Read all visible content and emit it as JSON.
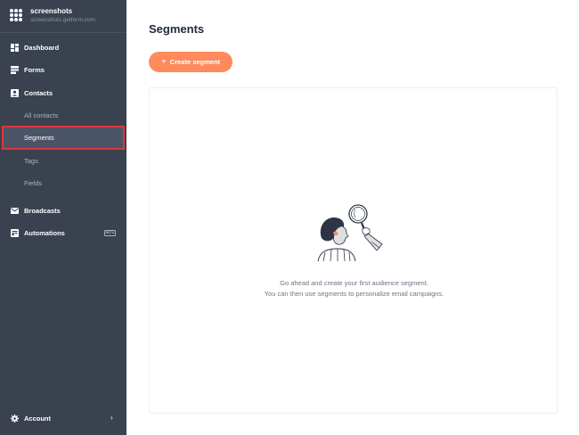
{
  "brand": {
    "name": "screenshots",
    "url": "screenshots.getform.com"
  },
  "sidebar": {
    "items": [
      {
        "label": "Dashboard",
        "icon": "dashboard-icon"
      },
      {
        "label": "Forms",
        "icon": "forms-icon"
      },
      {
        "label": "Contacts",
        "icon": "contacts-icon"
      }
    ],
    "contacts_sub": [
      {
        "label": "All contacts"
      },
      {
        "label": "Segments",
        "active": true
      },
      {
        "label": "Tags"
      },
      {
        "label": "Fields"
      }
    ],
    "broadcasts": {
      "label": "Broadcasts",
      "icon": "mail-icon"
    },
    "automations": {
      "label": "Automations",
      "icon": "automations-icon",
      "badge": "BETA"
    },
    "account": {
      "label": "Account",
      "icon": "gear-icon"
    }
  },
  "main": {
    "title": "Segments",
    "create_button": "Create segment",
    "empty_state": {
      "line1": "Go ahead and create your first audience segment.",
      "line2": "You can then use segments to personalize email campaigns.",
      "illustration": "magnifier-person-illustration"
    }
  },
  "colors": {
    "sidebar_bg": "#3a4250",
    "accent": "#ff8a5c",
    "highlight_border": "#e0343c"
  }
}
